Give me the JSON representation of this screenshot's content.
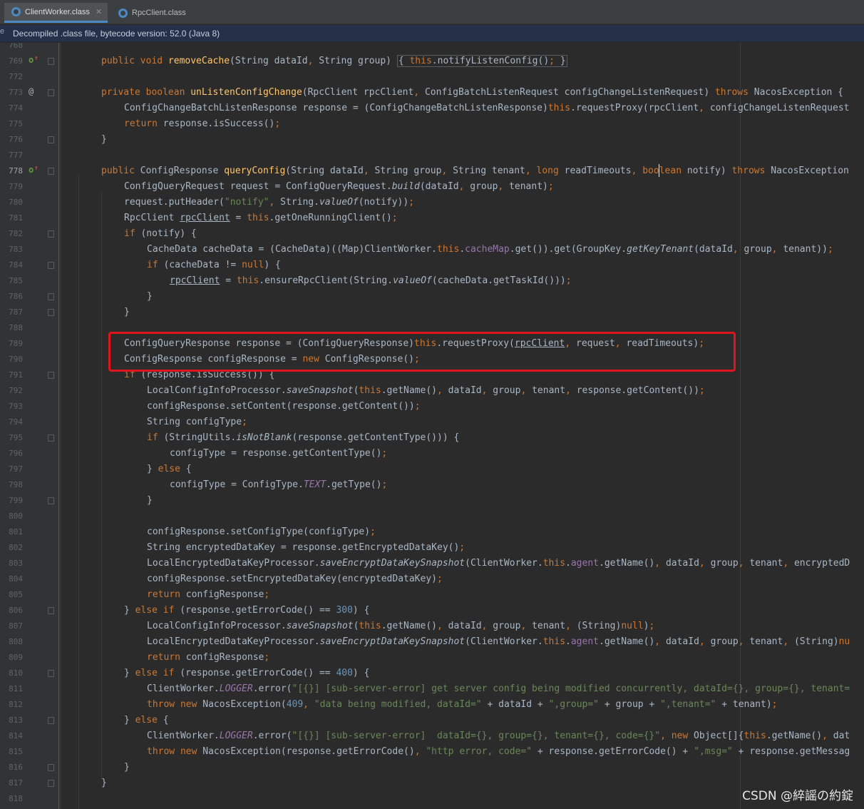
{
  "tabs": [
    {
      "label": "ClientWorker.class",
      "icon": "class-file-icon",
      "active": true
    },
    {
      "label": "RpcClient.class",
      "icon": "class-file-icon",
      "active": false
    }
  ],
  "banner": {
    "text": "Decompiled .class file, bytecode version: 52.0 (Java 8)",
    "edge_letter": "e"
  },
  "gutter": {
    "current_line": "778"
  },
  "watermark": "CSDN @綷謡の約錠",
  "lines": [
    {
      "n": "768",
      "code": ""
    },
    {
      "n": "769",
      "code": "public void removeCache(String dataId, String group) { this.notifyListenConfig(); }"
    },
    {
      "n": "772",
      "code": ""
    },
    {
      "n": "773",
      "code": "private boolean unListenConfigChange(RpcClient rpcClient, ConfigBatchListenRequest configChangeListenRequest) throws NacosException {"
    },
    {
      "n": "774",
      "code": "ConfigChangeBatchListenResponse response = (ConfigChangeBatchListenResponse)this.requestProxy(rpcClient, configChangeListenRequest"
    },
    {
      "n": "775",
      "code": "return response.isSuccess();"
    },
    {
      "n": "776",
      "code": "}"
    },
    {
      "n": "777",
      "code": ""
    },
    {
      "n": "778",
      "code": "public ConfigResponse queryConfig(String dataId, String group, String tenant, long readTimeouts, boolean notify) throws NacosException"
    },
    {
      "n": "779",
      "code": "ConfigQueryRequest request = ConfigQueryRequest.build(dataId, group, tenant);"
    },
    {
      "n": "780",
      "code": "request.putHeader(\"notify\", String.valueOf(notify));"
    },
    {
      "n": "781",
      "code": "RpcClient rpcClient = this.getOneRunningClient();"
    },
    {
      "n": "782",
      "code": "if (notify) {"
    },
    {
      "n": "783",
      "code": "CacheData cacheData = (CacheData)((Map)ClientWorker.this.cacheMap.get()).get(GroupKey.getKeyTenant(dataId, group, tenant));"
    },
    {
      "n": "784",
      "code": "if (cacheData != null) {"
    },
    {
      "n": "785",
      "code": "rpcClient = this.ensureRpcClient(String.valueOf(cacheData.getTaskId()));"
    },
    {
      "n": "786",
      "code": "}"
    },
    {
      "n": "787",
      "code": "}"
    },
    {
      "n": "788",
      "code": ""
    },
    {
      "n": "789",
      "code": "ConfigQueryResponse response = (ConfigQueryResponse)this.requestProxy(rpcClient, request, readTimeouts);"
    },
    {
      "n": "790",
      "code": "ConfigResponse configResponse = new ConfigResponse();"
    },
    {
      "n": "791",
      "code": "if (response.isSuccess()) {"
    },
    {
      "n": "792",
      "code": "LocalConfigInfoProcessor.saveSnapshot(this.getName(), dataId, group, tenant, response.getContent());"
    },
    {
      "n": "793",
      "code": "configResponse.setContent(response.getContent());"
    },
    {
      "n": "794",
      "code": "String configType;"
    },
    {
      "n": "795",
      "code": "if (StringUtils.isNotBlank(response.getContentType())) {"
    },
    {
      "n": "796",
      "code": "configType = response.getContentType();"
    },
    {
      "n": "797",
      "code": "} else {"
    },
    {
      "n": "798",
      "code": "configType = ConfigType.TEXT.getType();"
    },
    {
      "n": "799",
      "code": "}"
    },
    {
      "n": "800",
      "code": ""
    },
    {
      "n": "801",
      "code": "configResponse.setConfigType(configType);"
    },
    {
      "n": "802",
      "code": "String encryptedDataKey = response.getEncryptedDataKey();"
    },
    {
      "n": "803",
      "code": "LocalEncryptedDataKeyProcessor.saveEncryptDataKeySnapshot(ClientWorker.this.agent.getName(), dataId, group, tenant, encryptedD"
    },
    {
      "n": "804",
      "code": "configResponse.setEncryptedDataKey(encryptedDataKey);"
    },
    {
      "n": "805",
      "code": "return configResponse;"
    },
    {
      "n": "806",
      "code": "} else if (response.getErrorCode() == 300) {"
    },
    {
      "n": "807",
      "code": "LocalConfigInfoProcessor.saveSnapshot(this.getName(), dataId, group, tenant, (String)null);"
    },
    {
      "n": "808",
      "code": "LocalEncryptedDataKeyProcessor.saveEncryptDataKeySnapshot(ClientWorker.this.agent.getName(), dataId, group, tenant, (String)nu"
    },
    {
      "n": "809",
      "code": "return configResponse;"
    },
    {
      "n": "810",
      "code": "} else if (response.getErrorCode() == 400) {"
    },
    {
      "n": "811",
      "code": "ClientWorker.LOGGER.error(\"[{}] [sub-server-error] get server config being modified concurrently, dataId={}, group={}, tenant="
    },
    {
      "n": "812",
      "code": "throw new NacosException(409, \"data being modified, dataId=\" + dataId + \",group=\" + group + \",tenant=\" + tenant);"
    },
    {
      "n": "813",
      "code": "} else {"
    },
    {
      "n": "814",
      "code": "ClientWorker.LOGGER.error(\"[{}] [sub-server-error]  dataId={}, group={}, tenant={}, code={}\", new Object[]{this.getName(), dat"
    },
    {
      "n": "815",
      "code": "throw new NacosException(response.getErrorCode(), \"http error, code=\" + response.getErrorCode() + \",msg=\" + response.getMessag"
    },
    {
      "n": "816",
      "code": "}"
    },
    {
      "n": "817",
      "code": "}"
    },
    {
      "n": "818",
      "code": ""
    }
  ]
}
